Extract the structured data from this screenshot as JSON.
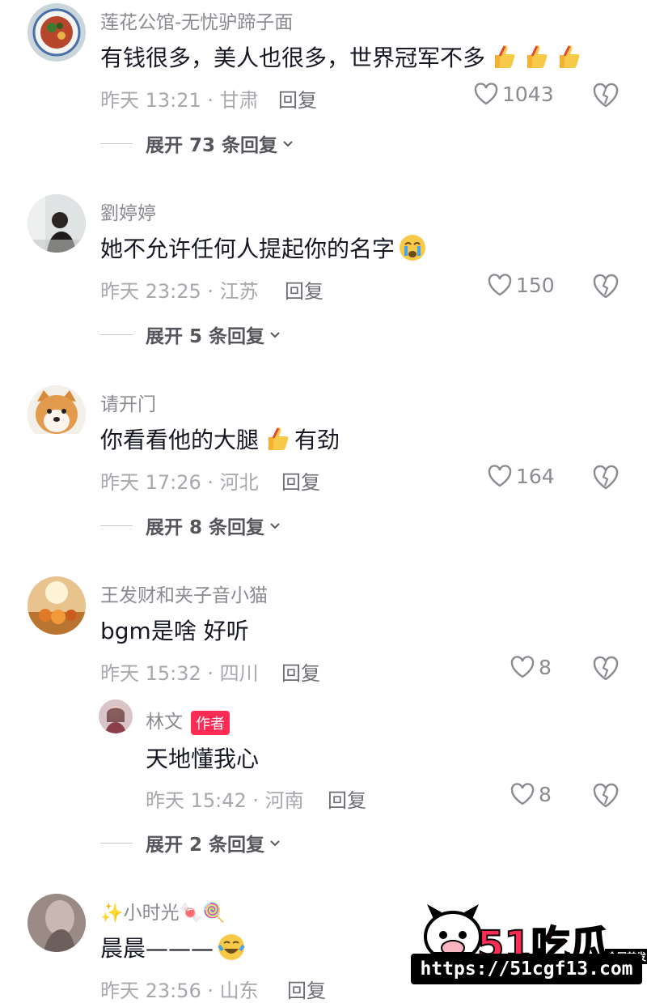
{
  "comments": [
    {
      "username": "莲花公馆-无忧驴蹄子面",
      "text": "有钱很多，美人也很多，世界冠军不多",
      "emoji_icons": [
        "thumbs-up-icon",
        "thumbs-up-icon",
        "thumbs-up-icon"
      ],
      "meta": "昨天 13:21 · 甘肃",
      "reply_label": "回复",
      "likes": "1043",
      "expand_label": "展开 73 条回复"
    },
    {
      "username": "劉婷婷",
      "text": "她不允许任何人提起你的名字",
      "emoji_icons": [
        "crying-face-icon"
      ],
      "meta": "昨天 23:25 · 江苏",
      "reply_label": "回复",
      "likes": "150",
      "expand_label": "展开 5 条回复"
    },
    {
      "username": "请开门",
      "text_before": "你看看他的大腿",
      "emoji_icons": [
        "thumbs-up-icon"
      ],
      "text_after": "有劲",
      "meta": "昨天 17:26 · 河北",
      "reply_label": "回复",
      "likes": "164",
      "expand_label": "展开 8 条回复"
    },
    {
      "username": "王发财和夹子音小猫",
      "text": "bgm是啥 好听",
      "meta": "昨天 15:32 · 四川",
      "reply_label": "回复",
      "likes": "8",
      "sub_reply": {
        "username": "林文",
        "badge": "作者",
        "text": "天地懂我心",
        "meta": "昨天 15:42 · 河南",
        "reply_label": "回复",
        "likes": "8"
      },
      "expand_label": "展开 2 条回复"
    },
    {
      "username": "✨小时光🍬🍭",
      "text": "晨晨———",
      "emoji_icons": [
        "laughing-tears-icon"
      ],
      "meta": "昨天 23:56 · 山东",
      "reply_label": "回复"
    }
  ],
  "watermark": {
    "logo_text": "51吃瓜",
    "badge_text": "全网首发",
    "url": "https://51cgf13.com"
  },
  "colors": {
    "accent": "#fe2c55",
    "username": "#8a8b91",
    "meta": "#a7a8ad",
    "text": "#161823"
  }
}
